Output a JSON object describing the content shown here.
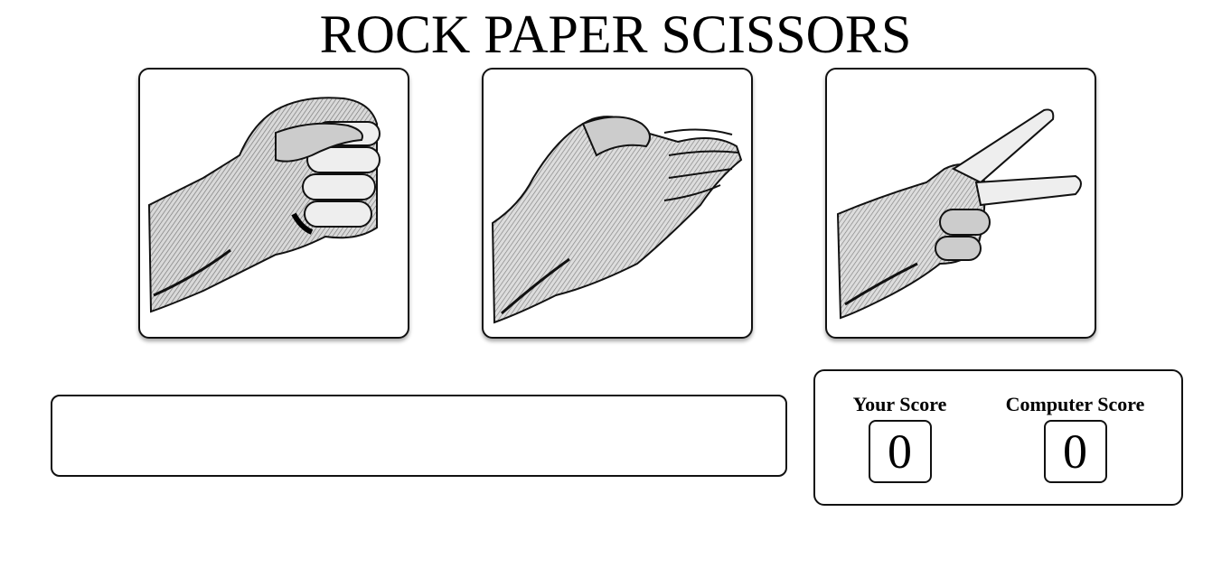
{
  "title": "ROCK PAPER SCISSORS",
  "choices": [
    {
      "id": "rock",
      "icon": "fist-hand-icon"
    },
    {
      "id": "paper",
      "icon": "open-hand-icon"
    },
    {
      "id": "scissors",
      "icon": "two-finger-hand-icon"
    }
  ],
  "result_message": "",
  "scores": {
    "player_label": "Your Score",
    "player_value": "0",
    "computer_label": "Computer Score",
    "computer_value": "0"
  }
}
